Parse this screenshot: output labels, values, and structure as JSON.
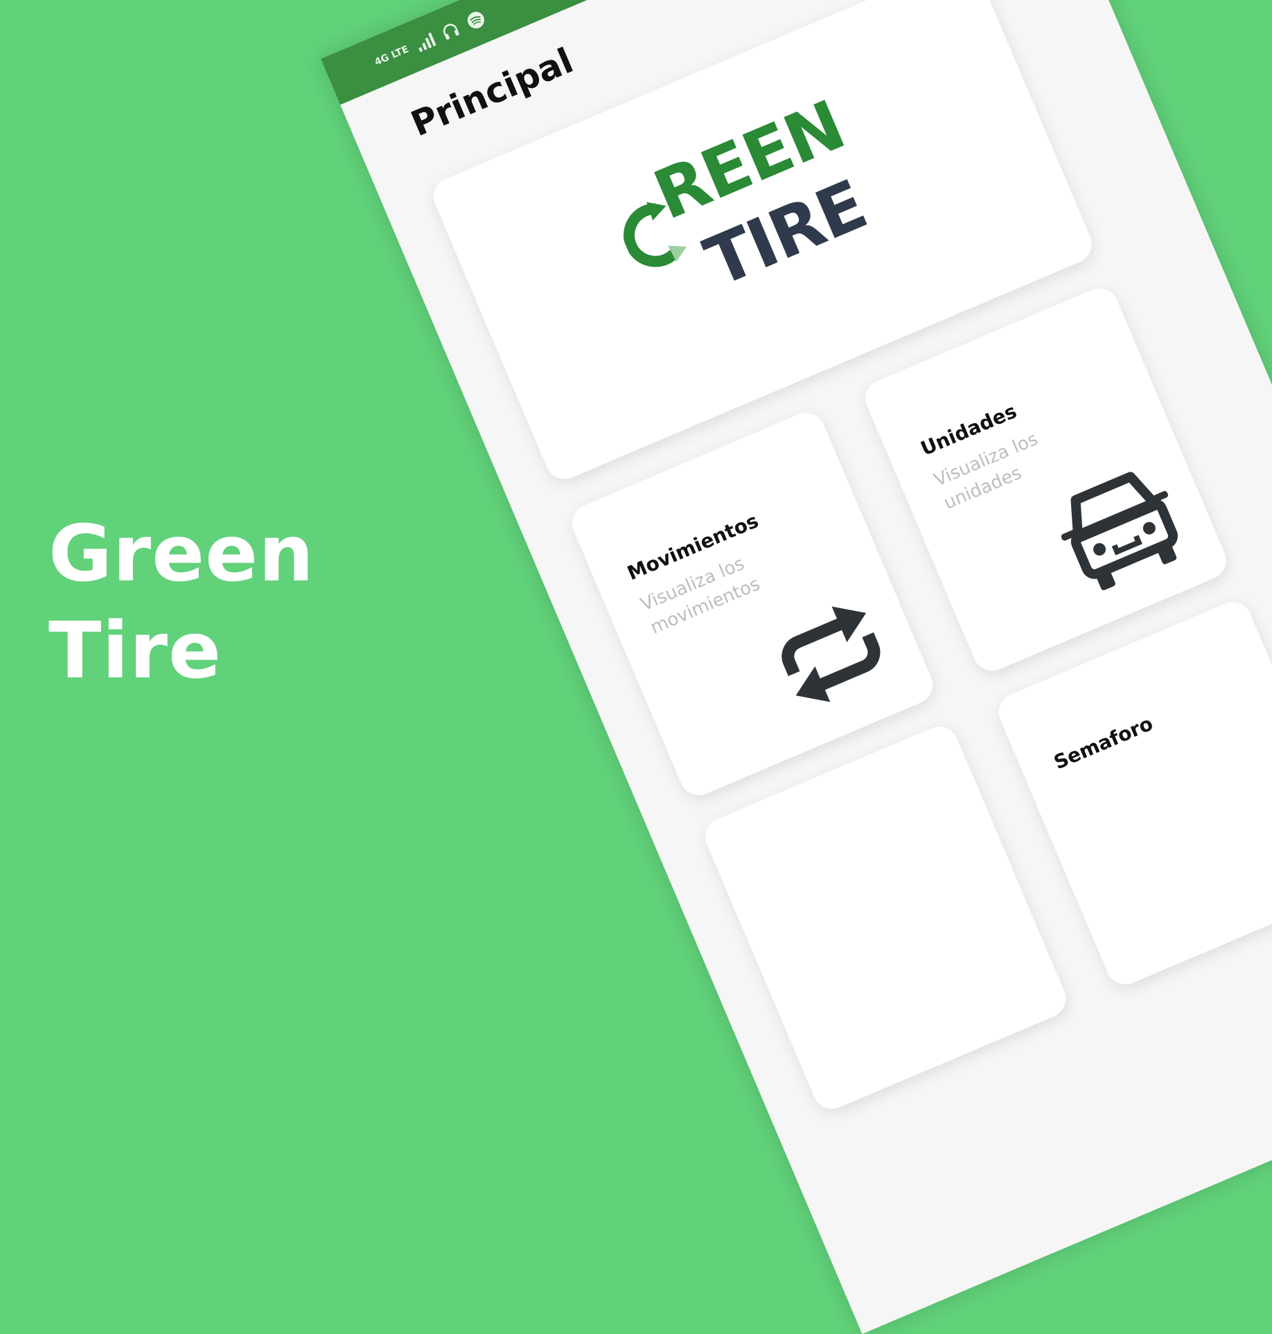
{
  "hero": {
    "line1": "Green",
    "line2": "Tire"
  },
  "status_bar": {
    "network": "4G LTE"
  },
  "header": {
    "title": "Principal"
  },
  "logo": {
    "word1": "REEN",
    "word2": "TIRE"
  },
  "cards": [
    {
      "title": "Movimientos",
      "subtitle": "Visualiza los movimientos",
      "icon": "repeat-icon"
    },
    {
      "title": "Unidades",
      "subtitle": "Visualiza los unidades",
      "icon": "car-icon"
    },
    {
      "title": "Semaforo",
      "subtitle": "",
      "icon": ""
    }
  ],
  "colors": {
    "background": "#61d17a",
    "status_bar": "#3a8f40",
    "logo_green": "#2a8a35",
    "logo_dark": "#2f3b4c",
    "icon_dark": "#2e3338"
  }
}
